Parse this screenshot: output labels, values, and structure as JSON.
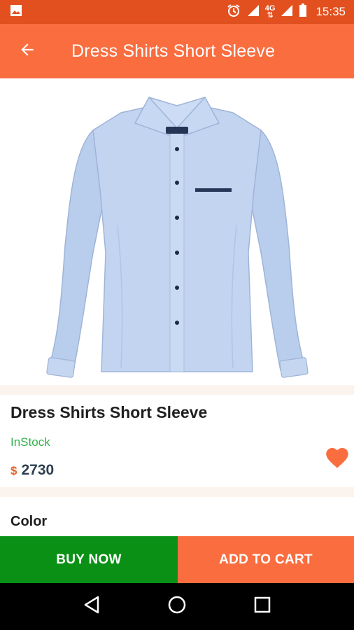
{
  "status_bar": {
    "time": "15:35",
    "network": "4G",
    "icons": [
      "image-icon",
      "alarm-icon",
      "signal-icon",
      "network-4g-icon",
      "signal-icon",
      "battery-icon"
    ]
  },
  "app_bar": {
    "title": "Dress Shirts Short Sleeve",
    "back_icon": "arrow-back-icon"
  },
  "product": {
    "image": "light-blue-dress-shirt",
    "name": "Dress Shirts Short Sleeve",
    "stock_status": "InStock",
    "currency": "$",
    "price": "2730",
    "favorite_icon": "heart-icon"
  },
  "options": {
    "color_label": "Color"
  },
  "actions": {
    "buy_now": "BUY NOW",
    "add_to_cart": "ADD TO CART"
  },
  "nav_bar": {
    "icons": [
      "back-triangle-icon",
      "home-circle-icon",
      "recents-square-icon"
    ]
  },
  "colors": {
    "status_bar": "#e2501f",
    "app_bar": "#f96d3f",
    "buy_now": "#0a9115",
    "add_to_cart": "#f96d3f",
    "in_stock": "#2db34a",
    "price": "#2e3f4f",
    "currency": "#e8632d",
    "heart": "#f96d3f",
    "separator": "#fbf4ee"
  }
}
